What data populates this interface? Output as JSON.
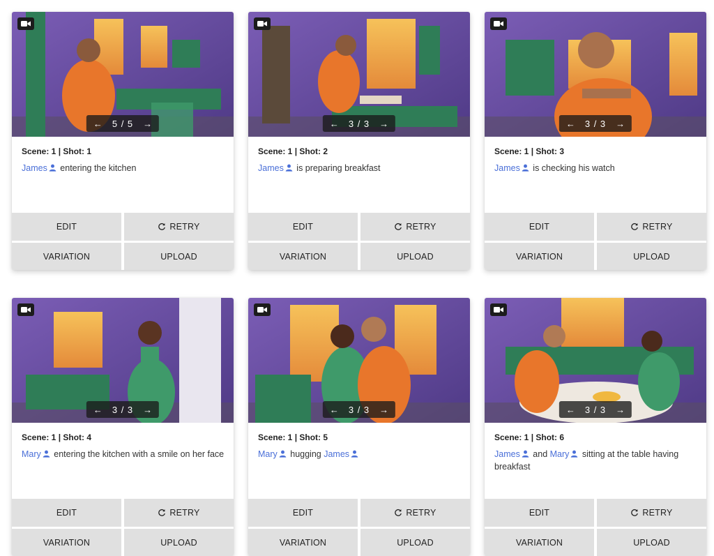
{
  "cards": [
    {
      "meta": "Scene: 1 | Shot: 1",
      "counter": "5 / 5",
      "desc_parts": [
        {
          "char": "James"
        },
        {
          "text": " entering the kitchen"
        }
      ],
      "buttons": {
        "edit": "EDIT",
        "retry": "RETRY",
        "variation": "VARIATION",
        "upload": "UPLOAD"
      }
    },
    {
      "meta": "Scene: 1 | Shot: 2",
      "counter": "3 / 3",
      "desc_parts": [
        {
          "char": "James"
        },
        {
          "text": " is preparing breakfast"
        }
      ],
      "buttons": {
        "edit": "EDIT",
        "retry": "RETRY",
        "variation": "VARIATION",
        "upload": "UPLOAD"
      }
    },
    {
      "meta": "Scene: 1 | Shot: 3",
      "counter": "3 / 3",
      "desc_parts": [
        {
          "char": "James"
        },
        {
          "text": " is checking his watch"
        }
      ],
      "buttons": {
        "edit": "EDIT",
        "retry": "RETRY",
        "variation": "VARIATION",
        "upload": "UPLOAD"
      }
    },
    {
      "meta": "Scene: 1 | Shot: 4",
      "counter": "3 / 3",
      "desc_parts": [
        {
          "char": "Mary"
        },
        {
          "text": " entering the kitchen with a smile on her face"
        }
      ],
      "buttons": {
        "edit": "EDIT",
        "retry": "RETRY",
        "variation": "VARIATION",
        "upload": "UPLOAD"
      }
    },
    {
      "meta": "Scene: 1 | Shot: 5",
      "counter": "3 / 3",
      "desc_parts": [
        {
          "char": "Mary"
        },
        {
          "text": " hugging "
        },
        {
          "char": "James"
        }
      ],
      "buttons": {
        "edit": "EDIT",
        "retry": "RETRY",
        "variation": "VARIATION",
        "upload": "UPLOAD"
      }
    },
    {
      "meta": "Scene: 1 | Shot: 6",
      "counter": "3 / 3",
      "desc_parts": [
        {
          "char": "James"
        },
        {
          "text": " and "
        },
        {
          "char": "Mary"
        },
        {
          "text": " sitting at the table having breakfast"
        }
      ],
      "buttons": {
        "edit": "EDIT",
        "retry": "RETRY",
        "variation": "VARIATION",
        "upload": "UPLOAD"
      }
    }
  ],
  "icons": {
    "camera": "video-camera-icon",
    "prev": "arrow-left-icon",
    "next": "arrow-right-icon",
    "person": "person-icon",
    "retry": "refresh-icon"
  },
  "colors": {
    "character_link": "#4a6fd8",
    "button_bg": "#e0e0e0",
    "wall_purple": "#6a4f9e",
    "shirt_orange": "#e8762b",
    "cabinet_green": "#2f7d57"
  }
}
